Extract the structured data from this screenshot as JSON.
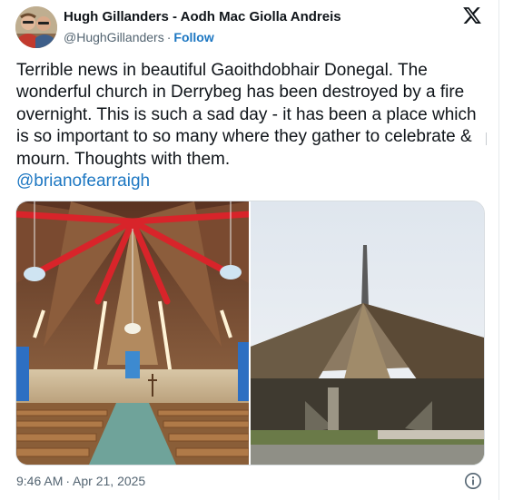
{
  "tweet": {
    "author_name": "Hugh Gillanders - Aodh Mac Giolla Andreis",
    "handle": "@HughGillanders",
    "separator": "·",
    "follow_label": "Follow",
    "text": "Terrible news in beautiful Gaoithdobhair Donegal. The wonderful church in Derrybeg has been destroyed by a fire overnight. This is such a sad day -  it has been a place which is so important to so many where they gather to celebrate & mourn. Thoughts with them.",
    "mention": "@brianofearraigh",
    "time": "9:46 AM",
    "date": "Apr 21, 2025"
  },
  "icons": {
    "platform_logo": "x-logo-icon",
    "info": "info-icon"
  },
  "colors": {
    "link": "#1d77c2",
    "text": "#0f1419",
    "muted": "#536471",
    "border": "#d8dde1"
  }
}
